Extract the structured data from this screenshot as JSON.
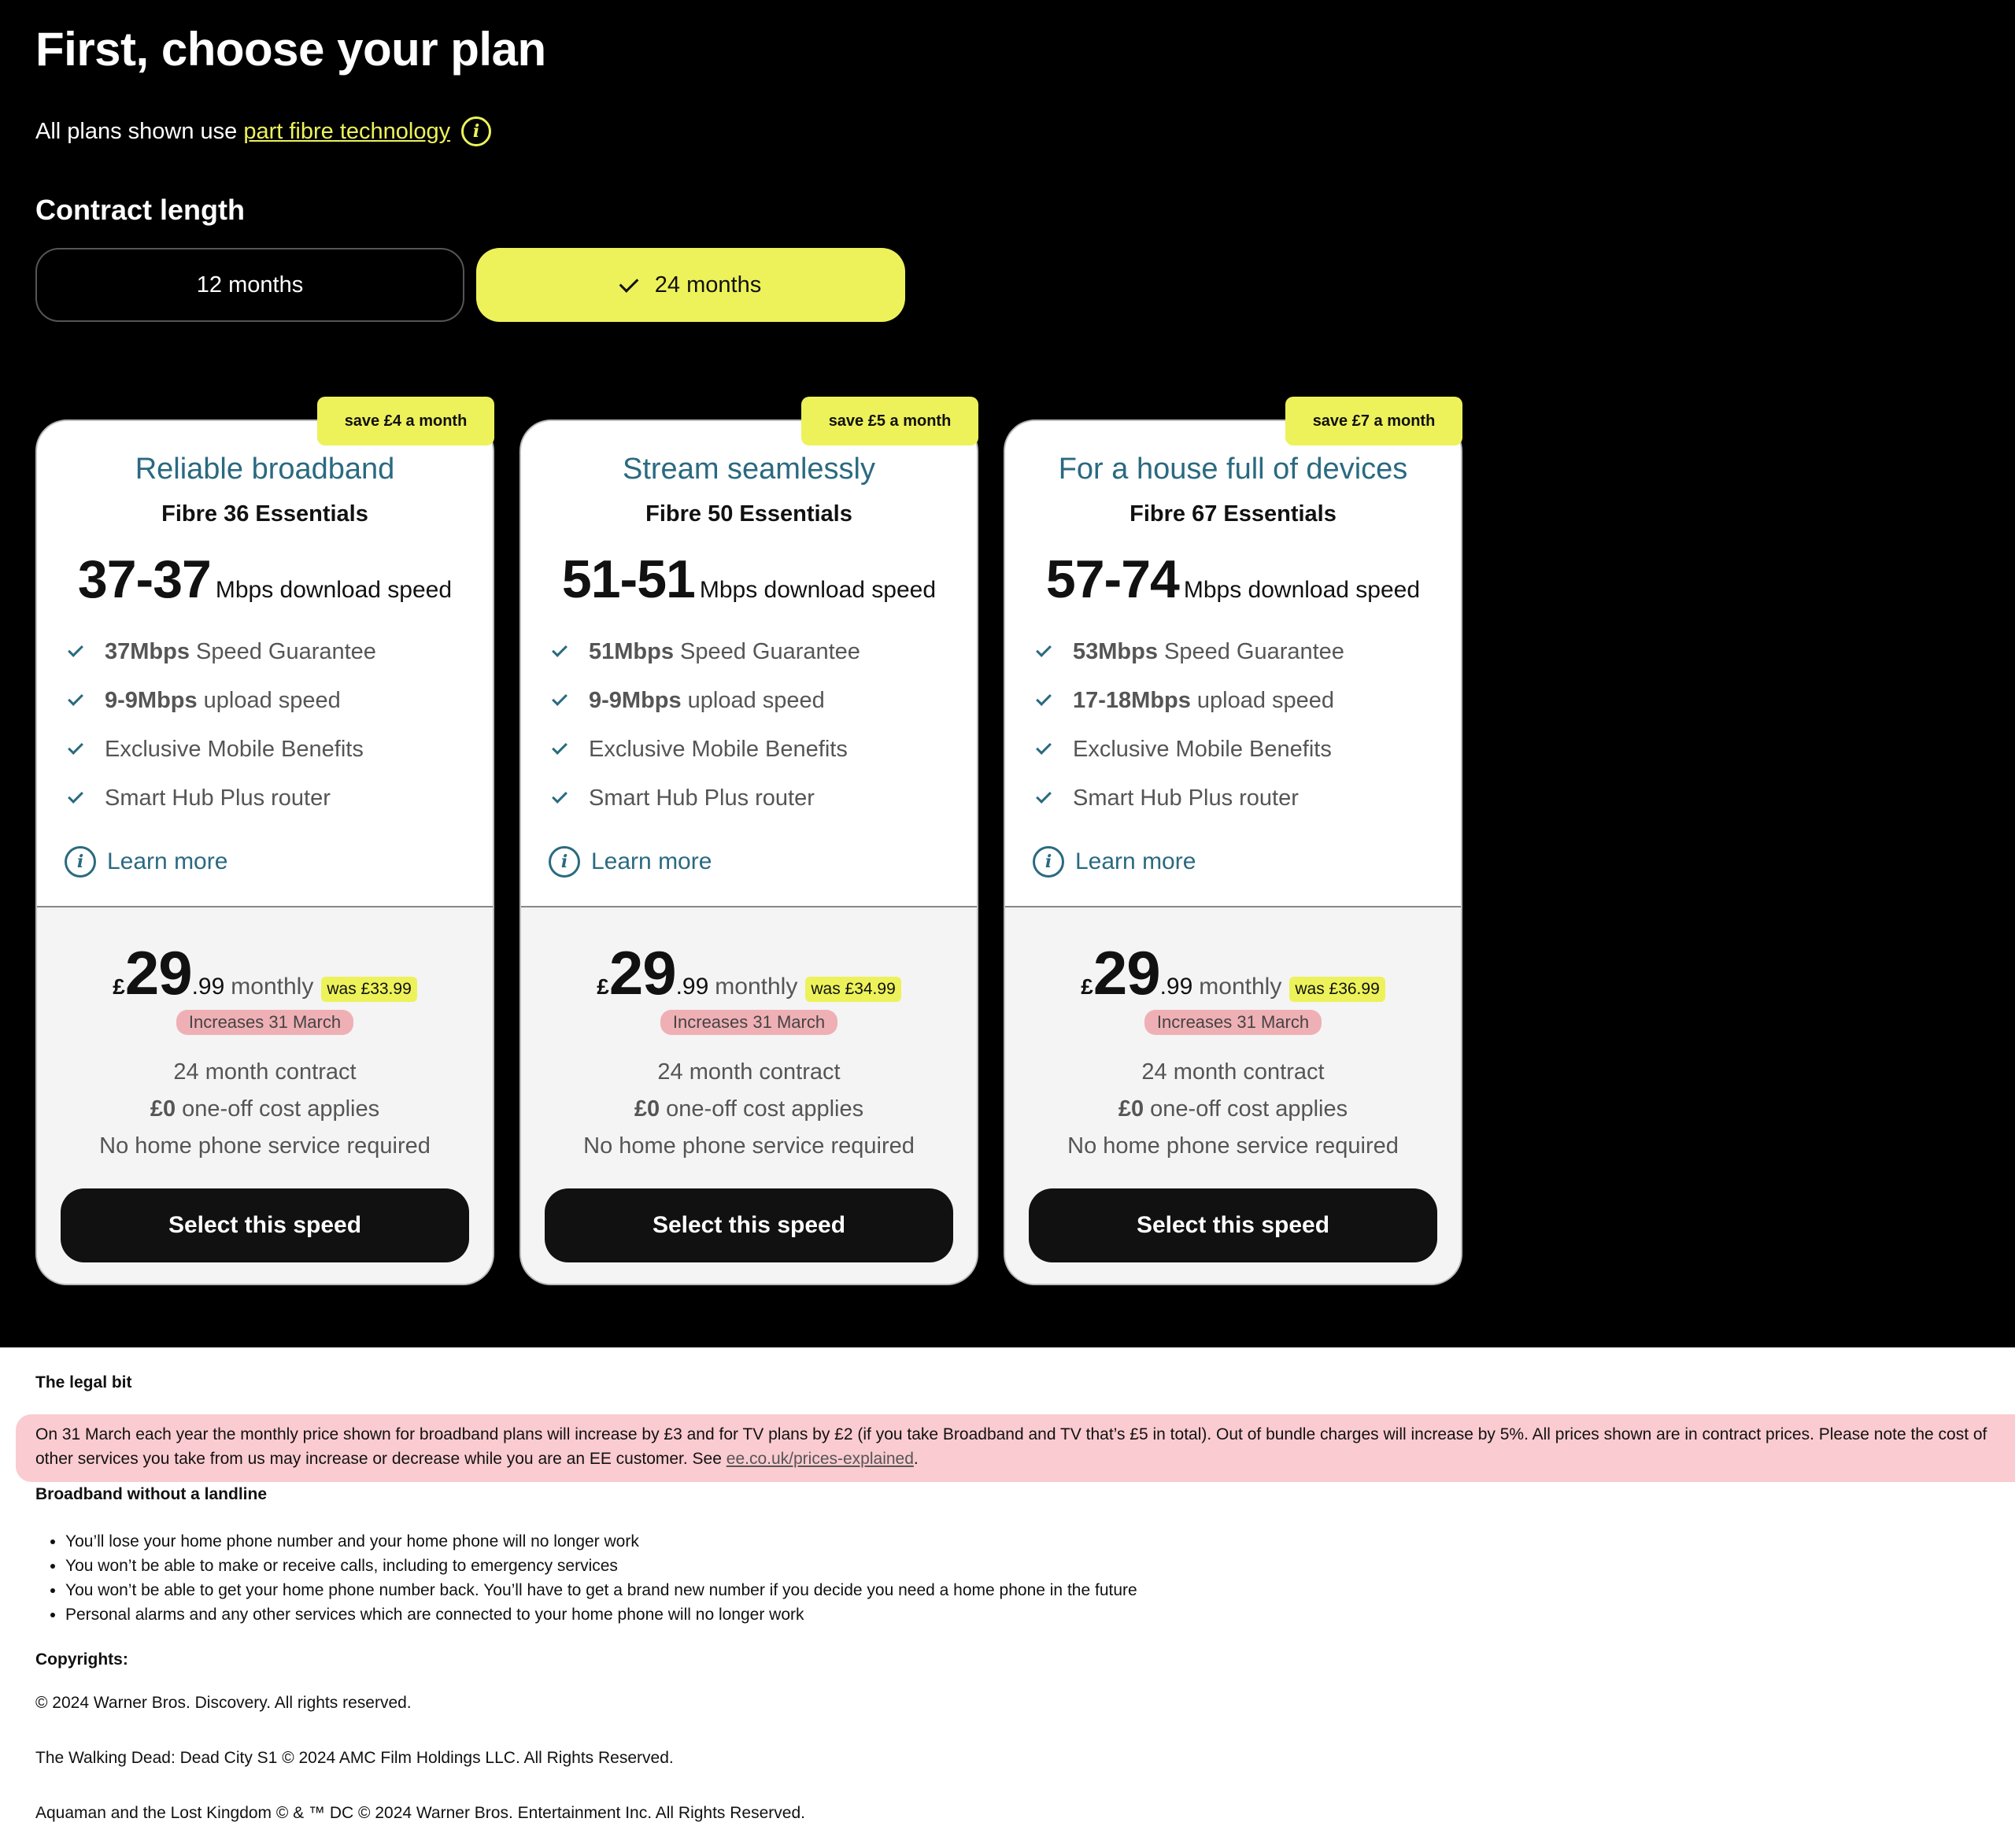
{
  "header": {
    "title": "First, choose your plan",
    "intro_text": "All plans shown use",
    "intro_link": "part fibre technology",
    "info_icon": "info-icon"
  },
  "contract": {
    "label": "Contract length",
    "options": [
      "12 months",
      "24 months"
    ],
    "selected": "24 months"
  },
  "plans": [
    {
      "badge": "save £4 a month",
      "headline": "Reliable broadband",
      "name": "Fibre 36 Essentials",
      "speed_range": "37-37",
      "speed_unit": "Mbps download speed",
      "features": [
        {
          "bold": "37Mbps",
          "text": "Speed Guarantee"
        },
        {
          "bold": "9-9Mbps",
          "text": "upload speed"
        },
        {
          "bold": "",
          "text": "Exclusive Mobile Benefits"
        },
        {
          "bold": "",
          "text": "Smart Hub Plus router"
        }
      ],
      "learn_more": "Learn more",
      "currency": "£",
      "price_whole": "29",
      "price_pence": ".99",
      "period": "monthly",
      "was": "was £33.99",
      "increase_note": "Increases 31 March",
      "contract_term": "24 month contract",
      "upfront_bold": "£0",
      "upfront_text": "one-off cost applies",
      "phone_note": "No home phone service required",
      "cta": "Select this speed"
    },
    {
      "badge": "save £5 a month",
      "headline": "Stream seamlessly",
      "name": "Fibre 50 Essentials",
      "speed_range": "51-51",
      "speed_unit": "Mbps download speed",
      "features": [
        {
          "bold": "51Mbps",
          "text": "Speed Guarantee"
        },
        {
          "bold": "9-9Mbps",
          "text": "upload speed"
        },
        {
          "bold": "",
          "text": "Exclusive Mobile Benefits"
        },
        {
          "bold": "",
          "text": "Smart Hub Plus router"
        }
      ],
      "learn_more": "Learn more",
      "currency": "£",
      "price_whole": "29",
      "price_pence": ".99",
      "period": "monthly",
      "was": "was £34.99",
      "increase_note": "Increases 31 March",
      "contract_term": "24 month contract",
      "upfront_bold": "£0",
      "upfront_text": "one-off cost applies",
      "phone_note": "No home phone service required",
      "cta": "Select this speed"
    },
    {
      "badge": "save £7 a month",
      "headline": "For a house full of devices",
      "name": "Fibre 67 Essentials",
      "speed_range": "57-74",
      "speed_unit": "Mbps download speed",
      "features": [
        {
          "bold": "53Mbps",
          "text": "Speed Guarantee"
        },
        {
          "bold": "17-18Mbps",
          "text": "upload speed"
        },
        {
          "bold": "",
          "text": "Exclusive Mobile Benefits"
        },
        {
          "bold": "",
          "text": "Smart Hub Plus router"
        }
      ],
      "learn_more": "Learn more",
      "currency": "£",
      "price_whole": "29",
      "price_pence": ".99",
      "period": "monthly",
      "was": "was £36.99",
      "increase_note": "Increases 31 March",
      "contract_term": "24 month contract",
      "upfront_bold": "£0",
      "upfront_text": "one-off cost applies",
      "phone_note": "No home phone service required",
      "cta": "Select this speed"
    }
  ],
  "legal": {
    "heading": "The legal bit",
    "text": "On 31 March each year the monthly price shown for broadband plans will increase by £3 and for TV plans by £2 (if you take Broadband and TV that’s £5 in total). Out of bundle charges will increase by 5%. All prices shown are in contract prices. Please note the cost of other services you take from us may increase or decrease while you are an EE customer. See",
    "link": "ee.co.uk/prices-explained",
    "link_suffix": ".",
    "landline_heading": "Broadband without a landline",
    "landline_items": [
      "You’ll lose your home phone number and your home phone will no longer work",
      "You won’t be able to make or receive calls, including to emergency services",
      "You won’t be able to get your home phone number back. You’ll have to get a brand new number if you decide you need a home phone in the future",
      "Personal alarms and any other services which are connected to your home phone will no longer work"
    ],
    "copyright_heading": "Copyrights:",
    "copyrights": [
      "© 2024 Warner Bros. Discovery. All rights reserved.",
      "The Walking Dead: Dead City S1 © 2024 AMC Film Holdings LLC. All Rights Reserved.",
      "Aquaman and the Lost Kingdom © & ™ DC © 2024 Warner Bros. Entertainment Inc. All Rights Reserved."
    ]
  },
  "colors": {
    "accent_yellow": "#edf25a",
    "teal": "#2a6a80",
    "highlight_red": "#eb7882"
  }
}
